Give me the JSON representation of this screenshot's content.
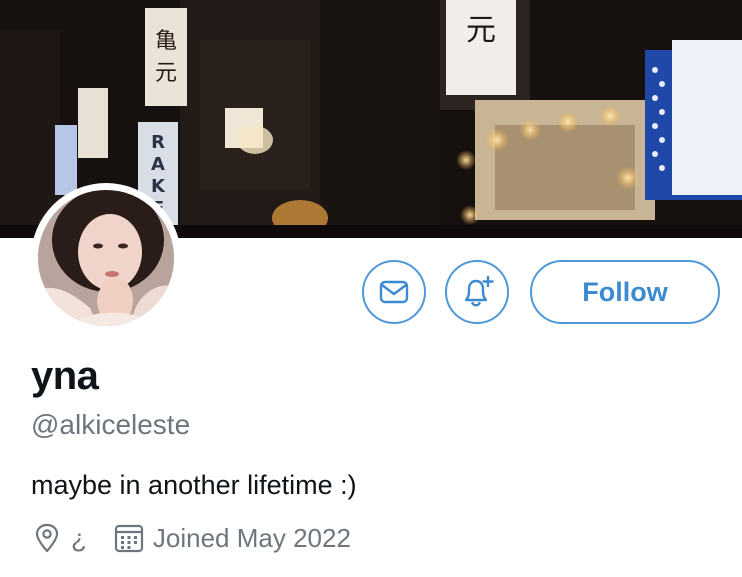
{
  "profile": {
    "display_name": "yna",
    "handle": "@alkiceleste",
    "bio": "maybe in another lifetime :)",
    "location": "¿",
    "joined": "Joined May 2022"
  },
  "actions": {
    "follow_label": "Follow"
  },
  "banner": {
    "sign_texts": [
      "元",
      "RAKE"
    ]
  },
  "icons": {
    "message": "envelope-icon",
    "notify": "bell-plus-icon",
    "location": "map-pin-icon",
    "calendar": "calendar-icon"
  },
  "colors": {
    "accent": "#3b8bd1",
    "accent_border": "#4f98d8",
    "text_primary": "#0f1419",
    "text_secondary": "#6e767d",
    "background": "#ffffff"
  }
}
